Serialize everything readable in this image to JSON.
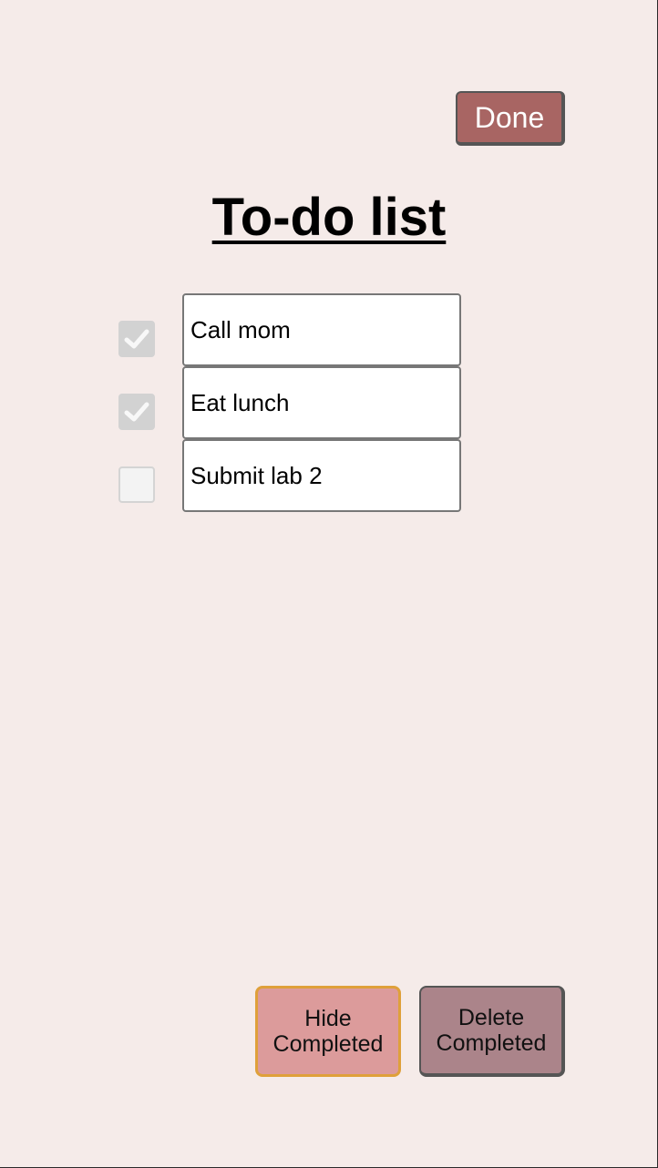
{
  "header": {
    "done_label": "Done"
  },
  "page": {
    "title": "To-do list"
  },
  "todos": [
    {
      "text": "Call mom",
      "checked": true
    },
    {
      "text": "Eat lunch",
      "checked": true
    },
    {
      "text": "Submit lab 2",
      "checked": false
    }
  ],
  "footer": {
    "hide_line1": "Hide",
    "hide_line2": "Completed",
    "delete_line1": "Delete",
    "delete_line2": "Completed"
  },
  "colors": {
    "background": "#f5ebe9",
    "done_button": "#a86563",
    "hide_button": "#dc9b9b",
    "hide_button_focus_ring": "#dfa03a",
    "delete_button": "#ab848a",
    "checkbox_checked": "#d2d2d2"
  },
  "icons": {
    "checkbox_mark": "checkmark-icon"
  }
}
